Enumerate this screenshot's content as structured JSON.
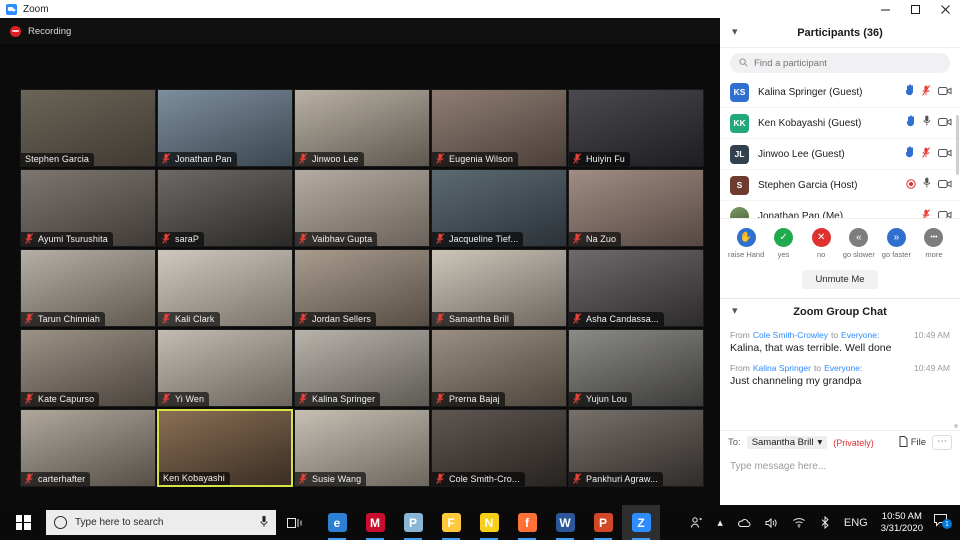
{
  "window": {
    "title": "Zoom",
    "app_icon": "zoom-icon",
    "minimize": "minimize",
    "maximize": "maximize",
    "close": "close"
  },
  "meeting": {
    "recording_label": "Recording",
    "participants": [
      {
        "name": "Stephen Garcia",
        "muted": false,
        "speaking": false,
        "bg": "#6b6457",
        "bg2": "#413a33"
      },
      {
        "name": "Jonathan Pan",
        "muted": true,
        "speaking": false,
        "bg": "#7e8e9c",
        "bg2": "#3b4651"
      },
      {
        "name": "Jinwoo Lee",
        "muted": true,
        "speaking": false,
        "bg": "#b9b1a6",
        "bg2": "#5f584e"
      },
      {
        "name": "Eugenia Wilson",
        "muted": true,
        "speaking": false,
        "bg": "#8e7d74",
        "bg2": "#4b3f39"
      },
      {
        "name": "Huiyin Fu",
        "muted": true,
        "speaking": false,
        "bg": "#4c4a50",
        "bg2": "#1e1d21"
      },
      {
        "name": "Ayumi Tsurushita",
        "muted": true,
        "speaking": false,
        "bg": "#7d7670",
        "bg2": "#413b37"
      },
      {
        "name": "saraP",
        "muted": true,
        "speaking": false,
        "bg": "#6d6a66",
        "bg2": "#2b2927"
      },
      {
        "name": "Vaibhav Gupta",
        "muted": true,
        "speaking": false,
        "bg": "#b4aca2",
        "bg2": "#6a625a"
      },
      {
        "name": "Jacqueline Tief...",
        "muted": true,
        "speaking": false,
        "bg": "#5d6a72",
        "bg2": "#2b3238"
      },
      {
        "name": "Na Zuo",
        "muted": true,
        "speaking": false,
        "bg": "#a08d84",
        "bg2": "#564842"
      },
      {
        "name": "Tarun Chinniah",
        "muted": true,
        "speaking": false,
        "bg": "#b5afa6",
        "bg2": "#60594f"
      },
      {
        "name": "Kali Clark",
        "muted": true,
        "speaking": false,
        "bg": "#cfc8bf",
        "bg2": "#7b746b"
      },
      {
        "name": "Jordan Sellers",
        "muted": true,
        "speaking": false,
        "bg": "#a89c8e",
        "bg2": "#574d44"
      },
      {
        "name": "Samantha Brill",
        "muted": true,
        "speaking": false,
        "bg": "#cdc6ba",
        "bg2": "#6e6760"
      },
      {
        "name": "Asha Candassa...",
        "muted": true,
        "speaking": false,
        "bg": "#6f6a6c",
        "bg2": "#2e2b2d"
      },
      {
        "name": "Kate Capurso",
        "muted": true,
        "speaking": false,
        "bg": "#9c9287",
        "bg2": "#4b443d"
      },
      {
        "name": "Yi Wen",
        "muted": true,
        "speaking": false,
        "bg": "#c3bcb2",
        "bg2": "#6a645c"
      },
      {
        "name": "Kalina Springer",
        "muted": true,
        "speaking": false,
        "bg": "#b8b3ab",
        "bg2": "#5e5a54"
      },
      {
        "name": "Prerna Bajaj",
        "muted": true,
        "speaking": false,
        "bg": "#9a8f82",
        "bg2": "#4d453c"
      },
      {
        "name": "Yujun Lou",
        "muted": true,
        "speaking": false,
        "bg": "#8c8b88",
        "bg2": "#3c3b39"
      },
      {
        "name": "carterhafter",
        "muted": true,
        "speaking": false,
        "bg": "#b0a89d",
        "bg2": "#554f47"
      },
      {
        "name": "Ken Kobayashi",
        "muted": false,
        "speaking": true,
        "bg": "#8a6f55",
        "bg2": "#3a2d22"
      },
      {
        "name": "Susie Wang",
        "muted": true,
        "speaking": false,
        "bg": "#c6bfb4",
        "bg2": "#6c665d"
      },
      {
        "name": "Cole Smith-Cro...",
        "muted": true,
        "speaking": false,
        "bg": "#5f5752",
        "bg2": "#272320"
      },
      {
        "name": "Pankhuri Agraw...",
        "muted": true,
        "speaking": false,
        "bg": "#77706b",
        "bg2": "#302c29"
      }
    ]
  },
  "participants_panel": {
    "collapse_icon": "chevron-down-icon",
    "title": "Participants (36)",
    "search_placeholder": "Find a participant",
    "search_value": "",
    "rows": [
      {
        "name": "Jonathan Pan (Me)",
        "initials": "",
        "avatar_color": "#6d8f5c",
        "photo": true,
        "raised_hand": false,
        "mic": "muted",
        "video": "on"
      },
      {
        "name": "Stephen Garcia (Host)",
        "initials": "S",
        "avatar_color": "#6e3b2f",
        "photo": false,
        "raised_hand": false,
        "mic": "unmuted",
        "video": "on",
        "recording_dot": true
      },
      {
        "name": "Jinwoo Lee (Guest)",
        "initials": "JL",
        "avatar_color": "#33404d",
        "photo": false,
        "raised_hand": true,
        "mic": "muted",
        "video": "on"
      },
      {
        "name": "Ken Kobayashi (Guest)",
        "initials": "KK",
        "avatar_color": "#21a97a",
        "photo": false,
        "raised_hand": true,
        "mic": "unmuted",
        "video": "on"
      },
      {
        "name": "Kalina Springer (Guest)",
        "initials": "KS",
        "avatar_color": "#2f6fd0",
        "photo": false,
        "raised_hand": true,
        "mic": "muted",
        "video": "on"
      }
    ]
  },
  "reactions": [
    {
      "label": "raise Hand",
      "icon": "raised-hand-icon",
      "color": "#2f6fd0",
      "glyph": "✋"
    },
    {
      "label": "yes",
      "icon": "check-icon",
      "color": "#21a94e",
      "glyph": "✓"
    },
    {
      "label": "no",
      "icon": "x-icon",
      "color": "#e03131",
      "glyph": "✕"
    },
    {
      "label": "go slower",
      "icon": "rewind-icon",
      "color": "#7d7d7d",
      "glyph": "«"
    },
    {
      "label": "go faster",
      "icon": "fast-forward-icon",
      "color": "#2f6fd0",
      "glyph": "»"
    },
    {
      "label": "more",
      "icon": "ellipsis-icon",
      "color": "#7d7d7d",
      "glyph": "•••"
    }
  ],
  "unmute_button": "Unmute Me",
  "chat": {
    "collapse_icon": "chevron-down-icon",
    "title": "Zoom Group Chat",
    "messages": [
      {
        "prefix": "From",
        "from": "Cole Smith-Crowley",
        "mid": "to",
        "to": "Everyone:",
        "time": "10:49 AM",
        "text": "Kalina, that was terrible. Well done"
      },
      {
        "prefix": "From",
        "from": "Kalina Springer",
        "mid": "to",
        "to": "Everyone:",
        "time": "10:49 AM",
        "text": "Just channeling my grandpa"
      }
    ],
    "to_label": "To:",
    "to_value": "Samantha Brill",
    "privately": "(Privately)",
    "file_label": "File",
    "more_label": "⋯",
    "input_placeholder": "Type message here..."
  },
  "taskbar": {
    "start_icon": "windows-icon",
    "search_placeholder": "Type here to search",
    "search_icon": "circle-search-icon",
    "mic_icon": "microphone-icon",
    "taskview_icon": "task-view-icon",
    "apps": [
      {
        "name": "edge-icon",
        "label": "e",
        "color": "#2d7fd3"
      },
      {
        "name": "mcafee-icon",
        "label": "M",
        "color": "#c8102e"
      },
      {
        "name": "paint-icon",
        "label": "P",
        "color": "#8ab6d6"
      },
      {
        "name": "explorer-icon",
        "label": "F",
        "color": "#ffc83d"
      },
      {
        "name": "sticky-notes-icon",
        "label": "N",
        "color": "#f7d117"
      },
      {
        "name": "firefox-icon",
        "label": "f",
        "color": "#ff7139"
      },
      {
        "name": "word-icon",
        "label": "W",
        "color": "#2b579a"
      },
      {
        "name": "powerpoint-icon",
        "label": "P",
        "color": "#d24726"
      },
      {
        "name": "zoom-icon",
        "label": "Z",
        "color": "#2d8cff"
      }
    ],
    "people_icon": "people-icon",
    "chevron_icon": "chevron-up-icon",
    "onedrive_icon": "onedrive-icon",
    "volume_icon": "volume-icon",
    "wifi_icon": "wifi-icon",
    "bluetooth_icon": "bluetooth-icon",
    "language": "ENG",
    "time": "10:50 AM",
    "date": "3/31/2020",
    "notification_icon": "notification-icon",
    "notification_count": "1"
  }
}
